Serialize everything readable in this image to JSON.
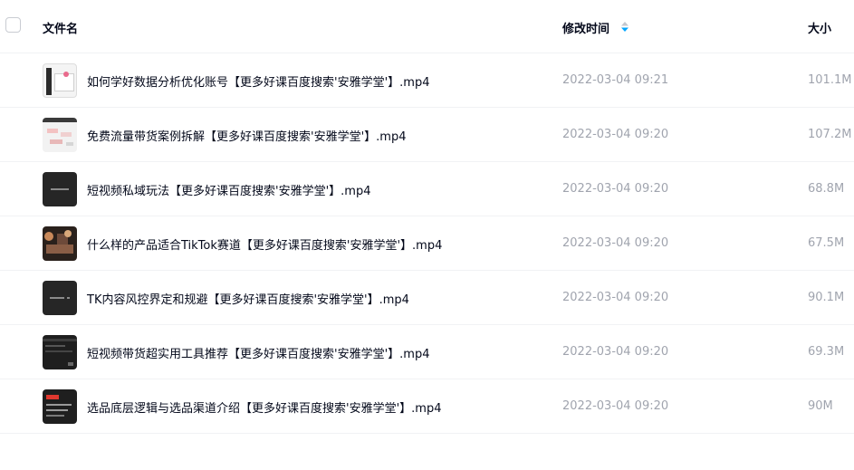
{
  "header": {
    "name_label": "文件名",
    "time_label": "修改时间",
    "size_label": "大小",
    "sort_color": "#06a7ff"
  },
  "files": [
    {
      "name": "如何学好数据分析优化账号【更多好课百度搜索'安雅学堂'】.mp4",
      "time": "2022-03-04 09:21",
      "size": "101.1M",
      "thumb": "light-chart"
    },
    {
      "name": "免费流量带货案例拆解【更多好课百度搜索'安雅学堂'】.mp4",
      "time": "2022-03-04 09:20",
      "size": "107.2M",
      "thumb": "light-mindmap"
    },
    {
      "name": "短视频私域玩法【更多好课百度搜索'安雅学堂'】.mp4",
      "time": "2022-03-04 09:20",
      "size": "68.8M",
      "thumb": "dark-text"
    },
    {
      "name": "什么样的产品适合TikTok赛道【更多好课百度搜索'安雅学堂'】.mp4",
      "time": "2022-03-04 09:20",
      "size": "67.5M",
      "thumb": "dark-photo"
    },
    {
      "name": "TK内容风控界定和规避【更多好课百度搜索'安雅学堂'】.mp4",
      "time": "2022-03-04 09:20",
      "size": "90.1M",
      "thumb": "dark-text"
    },
    {
      "name": "短视频带货超实用工具推荐【更多好课百度搜索'安雅学堂'】.mp4",
      "time": "2022-03-04 09:20",
      "size": "69.3M",
      "thumb": "dark-screen"
    },
    {
      "name": "选品底层逻辑与选品渠道介绍【更多好课百度搜索'安雅学堂'】.mp4",
      "time": "2022-03-04 09:20",
      "size": "90M",
      "thumb": "dark-red"
    }
  ]
}
